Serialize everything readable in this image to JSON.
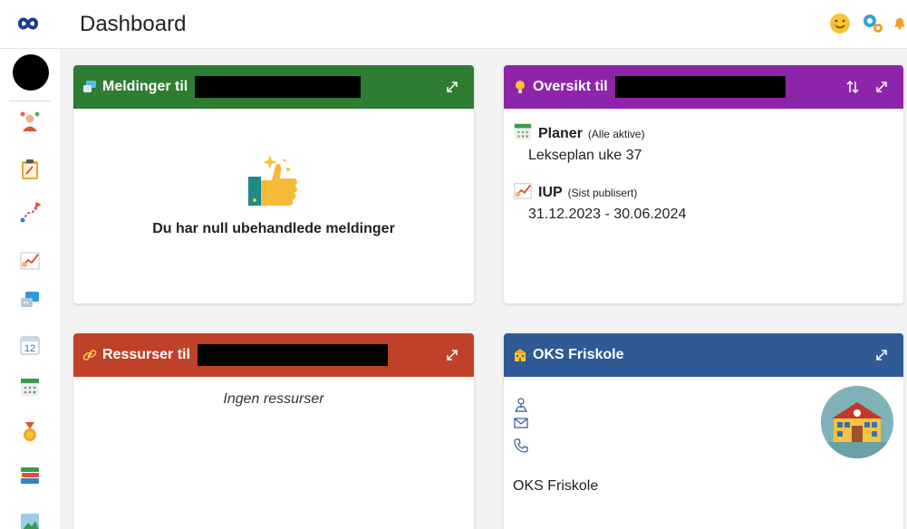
{
  "header": {
    "title": "Dashboard",
    "icons": [
      "infinity-logo-icon",
      "smiley-icon",
      "gears-icon",
      "bell-icon"
    ]
  },
  "sidebar": {
    "items": [
      "people-icon",
      "clipboard-icon",
      "route-icon",
      "chart-icon",
      "chat-icon",
      "calendar-12-icon",
      "planner-icon",
      "medal-icon",
      "books-icon",
      "picture-icon"
    ]
  },
  "messages_card": {
    "title": "Meldinger til",
    "empty_text": "Du har null ubehandlede meldinger",
    "color": "#2e7d32"
  },
  "overview_card": {
    "title": "Oversikt til",
    "color": "#8e24aa",
    "plans": {
      "title": "Planer",
      "sub": "(Alle aktive)",
      "value": "Lekseplan uke 37"
    },
    "iup": {
      "title": "IUP",
      "sub": "(Sist publisert)",
      "value": "31.12.2023 - 30.06.2024"
    }
  },
  "resources_card": {
    "title": "Ressurser til",
    "empty_text": "Ingen ressurser",
    "color": "#bf4129"
  },
  "school_card": {
    "title": "OKS Friskole",
    "name": "OKS Friskole",
    "color": "#2f5a96"
  }
}
